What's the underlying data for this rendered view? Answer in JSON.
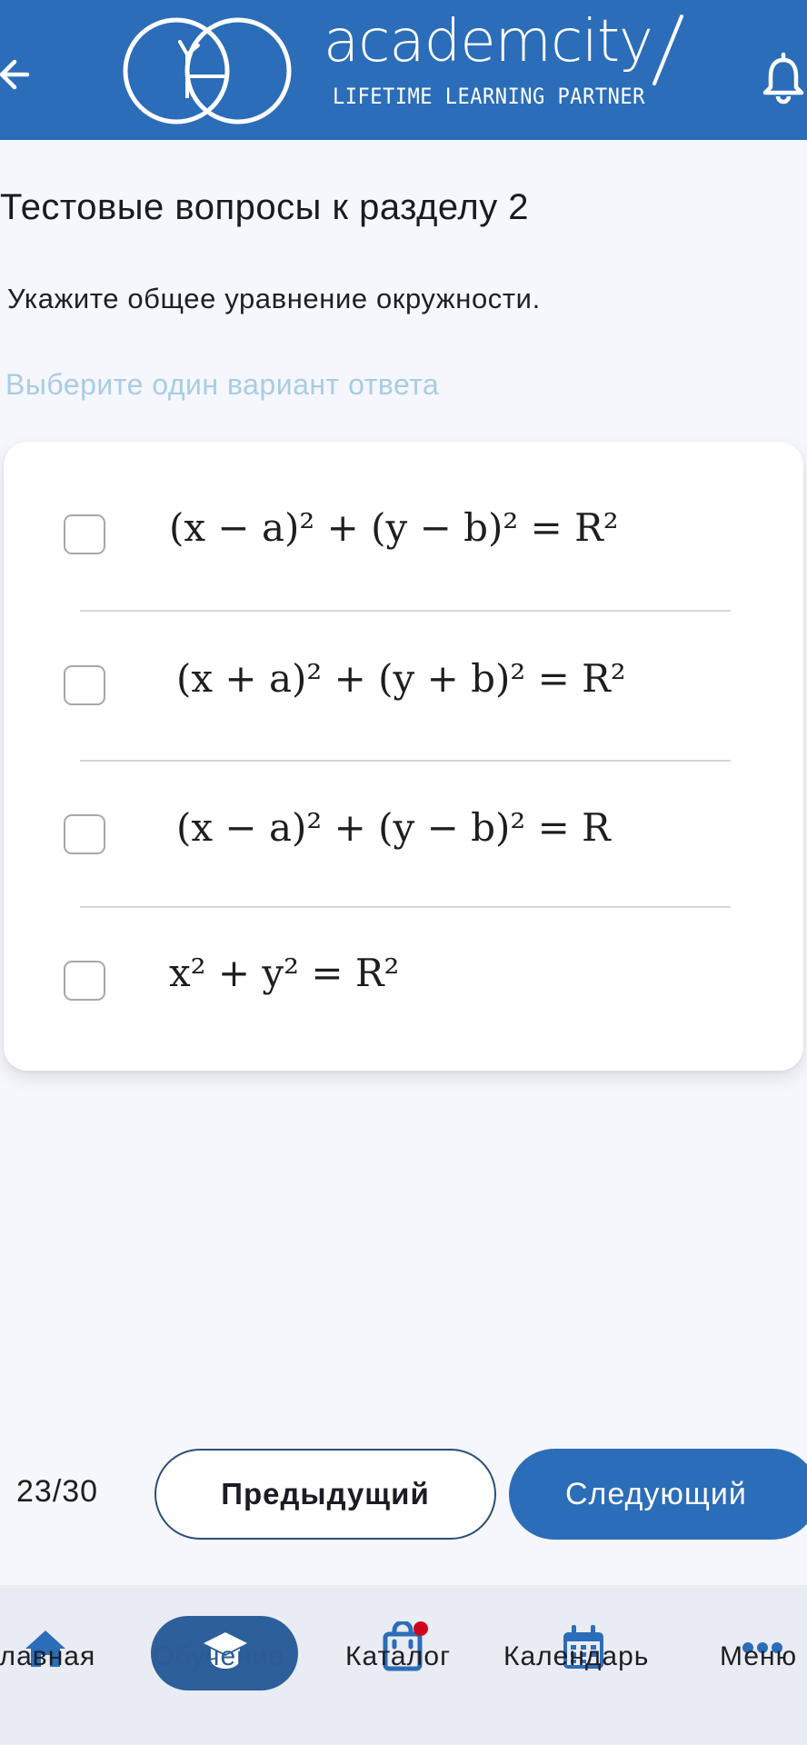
{
  "header": {
    "brand_name": "academcity",
    "tagline": "LIFETIME LEARNING PARTNER",
    "back_icon": "arrow-left-icon",
    "bell_icon": "bell-icon"
  },
  "page": {
    "title": "Тестовые вопросы к разделу 2",
    "question": "Укажите общее уравнение окружности.",
    "hint": "Выберите один вариант ответа"
  },
  "options": [
    {
      "formula": "(x − a)² + (y − b)² = R²",
      "checked": false
    },
    {
      "formula": "(x + a)² + (y + b)² = R²",
      "checked": false
    },
    {
      "formula": "(x − a)² + (y − b)² = R",
      "checked": false
    },
    {
      "formula": "x² + y² = R²",
      "checked": false
    }
  ],
  "pagination": {
    "counter": "23/30",
    "prev_label": "Предыдущий",
    "next_label": "Следующий"
  },
  "nav": {
    "items": [
      {
        "label": "Главная",
        "icon": "home-icon",
        "active": false,
        "badge": false
      },
      {
        "label": "Обучение",
        "icon": "graduation-cap-icon",
        "active": true,
        "badge": false
      },
      {
        "label": "Каталог",
        "icon": "shopping-bag-icon",
        "active": false,
        "badge": true
      },
      {
        "label": "Календарь",
        "icon": "calendar-icon",
        "active": false,
        "badge": false
      },
      {
        "label": "Меню",
        "icon": "more-dots-icon",
        "active": false,
        "badge": false
      }
    ]
  },
  "colors": {
    "brand": "#2b6db8",
    "active_nav": "#2d5f9a",
    "hint": "#a9cce4",
    "badge": "#d0021b"
  }
}
